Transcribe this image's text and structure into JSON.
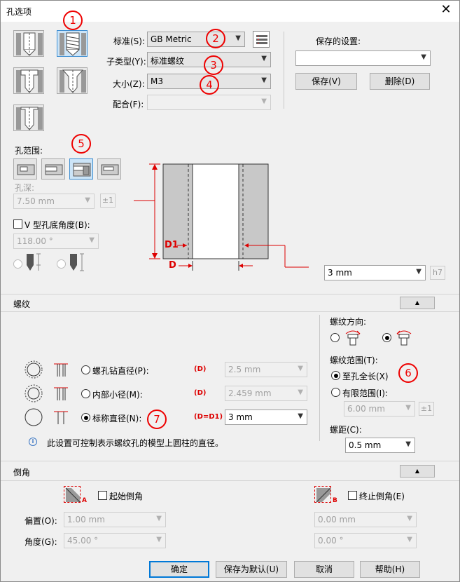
{
  "window": {
    "title": "孔选项",
    "close": "✕"
  },
  "top": {
    "standard_label": "标准(S):",
    "standard_value": "GB Metric",
    "subtype_label": "子类型(Y):",
    "subtype_value": "标准螺纹",
    "size_label": "大小(Z):",
    "size_value": "M3",
    "fit_label": "配合(F):",
    "fit_value": "",
    "saved_label": "保存的设置:",
    "saved_value": "",
    "save_btn": "保存(V)",
    "delete_btn": "删除(D)"
  },
  "range": {
    "label": "孔范围:",
    "depth_label": "孔深:",
    "depth_value": "7.50 mm",
    "tol": "±1",
    "vbottom_label": "V 型孔底角度(B):",
    "vbottom_value": "118.00 °"
  },
  "diagram": {
    "d1": "D1",
    "d": "D",
    "dim_value": "3 mm",
    "fit_code": "h7"
  },
  "thread": {
    "section": "螺纹",
    "direction_label": "螺纹方向:",
    "range_label": "螺纹范围(T):",
    "full_label": "至孔全长(X)",
    "limited_label": "有限范围(I):",
    "limited_value": "6.00 mm",
    "limited_tol": "±1",
    "pitch_label": "螺距(C):",
    "pitch_value": "0.5 mm",
    "rows": [
      {
        "label": "螺孔钻直径(P):",
        "tag": "(D)",
        "value": "2.5 mm"
      },
      {
        "label": "内部小径(M):",
        "tag": "(D)",
        "value": "2.459 mm"
      },
      {
        "label": "标称直径(N):",
        "tag": "(D=D1)",
        "value": "3 mm"
      }
    ],
    "info": "此设置可控制表示螺纹孔的模型上圆柱的直径。",
    "info_icon": "i"
  },
  "chamfer": {
    "section": "倒角",
    "start_label": "起始倒角",
    "end_label": "终止倒角(E)",
    "start_tag": "A",
    "end_tag": "B",
    "offset_label": "偏置(O):",
    "offset_start": "1.00 mm",
    "offset_end": "0.00 mm",
    "angle_label": "角度(G):",
    "angle_start": "45.00 °",
    "angle_end": "0.00 °"
  },
  "footer": {
    "ok": "确定",
    "save_default": "保存为默认(U)",
    "cancel": "取消",
    "help": "帮助(H)"
  },
  "annotations": [
    "1",
    "2",
    "3",
    "4",
    "5",
    "6",
    "7"
  ],
  "colors": {
    "accent": "#0078d7",
    "annotation": "#e00000",
    "selected": "#cce4f7"
  }
}
